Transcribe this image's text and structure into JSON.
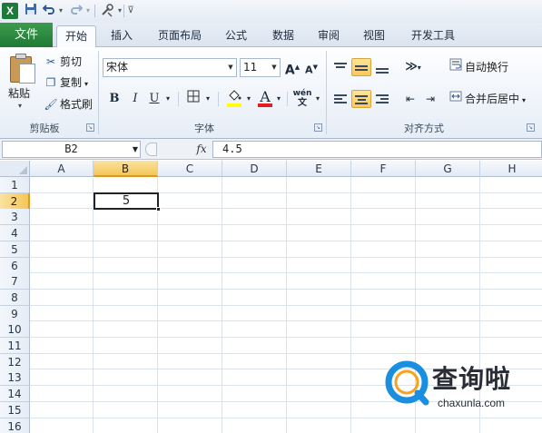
{
  "quick_access": {
    "app_icon_letter": "X",
    "save_icon": "save-icon",
    "undo_icon": "undo-icon",
    "redo_icon": "redo-icon",
    "customize_icon": "customize-icon"
  },
  "tabs": {
    "file": "文件",
    "items": [
      "开始",
      "插入",
      "页面布局",
      "公式",
      "数据",
      "审阅",
      "视图",
      "开发工具"
    ],
    "active": "开始"
  },
  "ribbon": {
    "clipboard": {
      "paste": "粘贴",
      "cut": "剪切",
      "copy": "复制",
      "format_painter": "格式刷",
      "group_label": "剪贴板"
    },
    "font": {
      "font_name": "宋体",
      "font_size": "11",
      "bold": "B",
      "italic": "I",
      "underline": "U",
      "grow": "A",
      "shrink": "A",
      "color_letter": "A",
      "phonetic": "wén",
      "group_label": "字体",
      "fill_color": "#ffff00",
      "font_color": "#e02020"
    },
    "alignment": {
      "wrap_text": "自动换行",
      "merge_center": "合并后居中",
      "group_label": "对齐方式"
    }
  },
  "formula_bar": {
    "name_box": "B2",
    "fx": "fx",
    "formula": "4.5"
  },
  "grid": {
    "columns": [
      "A",
      "B",
      "C",
      "D",
      "E",
      "F",
      "G",
      "H"
    ],
    "rows": [
      "1",
      "2",
      "3",
      "4",
      "5",
      "6",
      "7",
      "8",
      "9",
      "10",
      "11",
      "12",
      "13",
      "14",
      "15",
      "16"
    ],
    "selected_column": "B",
    "selected_row": "2",
    "active_cell_value": "5"
  },
  "watermark": {
    "text": "查询啦",
    "url": "chaxunla.com"
  }
}
